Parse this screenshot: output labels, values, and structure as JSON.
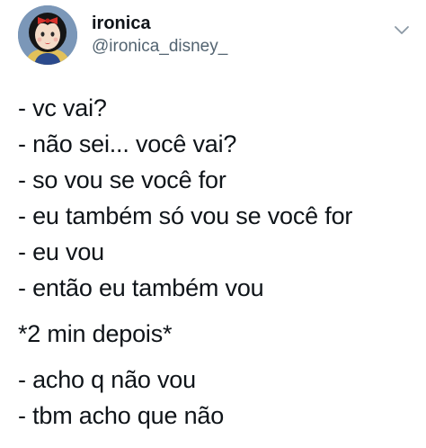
{
  "author": {
    "display_name": "ironica",
    "handle": "@ironica_disney_",
    "avatar_icon": "snow-white-avatar"
  },
  "menu_icon": "chevron-down-icon",
  "tweet": {
    "block1": [
      "- vc vai?",
      "- não sei... você vai?",
      "- so vou se você for",
      "- eu também só vou se você for",
      "- eu vou",
      "- então eu também vou"
    ],
    "interlude": "*2 min depois*",
    "block2": [
      "- acho q não vou",
      "- tbm acho que não"
    ]
  },
  "colors": {
    "text": "#0f1419",
    "secondary": "#536471",
    "background": "#ffffff"
  }
}
